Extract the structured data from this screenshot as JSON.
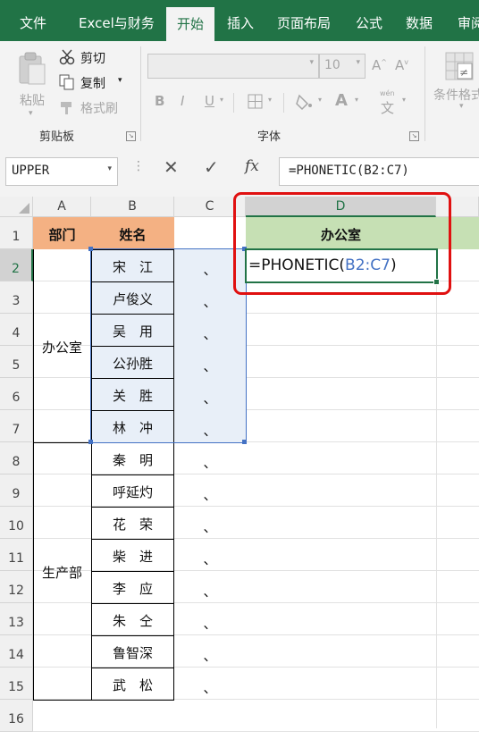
{
  "tabs": [
    "文件",
    "Excel与财务",
    "开始",
    "插入",
    "页面布局",
    "公式",
    "数据",
    "审阅"
  ],
  "ribbon": {
    "paste_label": "粘贴",
    "cut_label": "剪切",
    "copy_label": "复制",
    "format_painter_label": "格式刷",
    "clipboard_group": "剪贴板",
    "font_size": "10",
    "grow_font": "A",
    "shrink_font": "A",
    "bold": "B",
    "italic": "I",
    "underline": "U",
    "phonetic_glyph": "文",
    "phonetic_small": "wén",
    "font_group": "字体",
    "conditional_format_label": "条件格式"
  },
  "formula_bar": {
    "name_box": "UPPER",
    "cancel": "✕",
    "enter": "✓",
    "fx": "fx",
    "formula": "=PHONETIC(B2:C7)"
  },
  "columns": [
    "A",
    "B",
    "C",
    "D"
  ],
  "rows": [
    "1",
    "2",
    "3",
    "4",
    "5",
    "6",
    "7",
    "8",
    "9",
    "10",
    "11",
    "12",
    "13",
    "14",
    "15",
    "16"
  ],
  "headers": {
    "dept": "部门",
    "name": "姓名",
    "office": "办公室"
  },
  "groups": [
    "办公室",
    "生产部"
  ],
  "names": [
    "宋　江",
    "卢俊义",
    "吴　用",
    "公孙胜",
    "关　胜",
    "林　冲",
    "秦　明",
    "呼延灼",
    "花　荣",
    "柴　进",
    "李　应",
    "朱　仝",
    "鲁智深",
    "武　松"
  ],
  "separator": "、",
  "editing": {
    "prefix": "=PHONETIC(",
    "ref": "B2:C7",
    "suffix": ")"
  },
  "colors": {
    "excel_green": "#217346",
    "header_orange": "#f4b183",
    "header_green": "#c6e0b4",
    "selection_fill": "#e8eff8",
    "range_blue": "#4472c4",
    "highlight_red": "#e01010"
  }
}
